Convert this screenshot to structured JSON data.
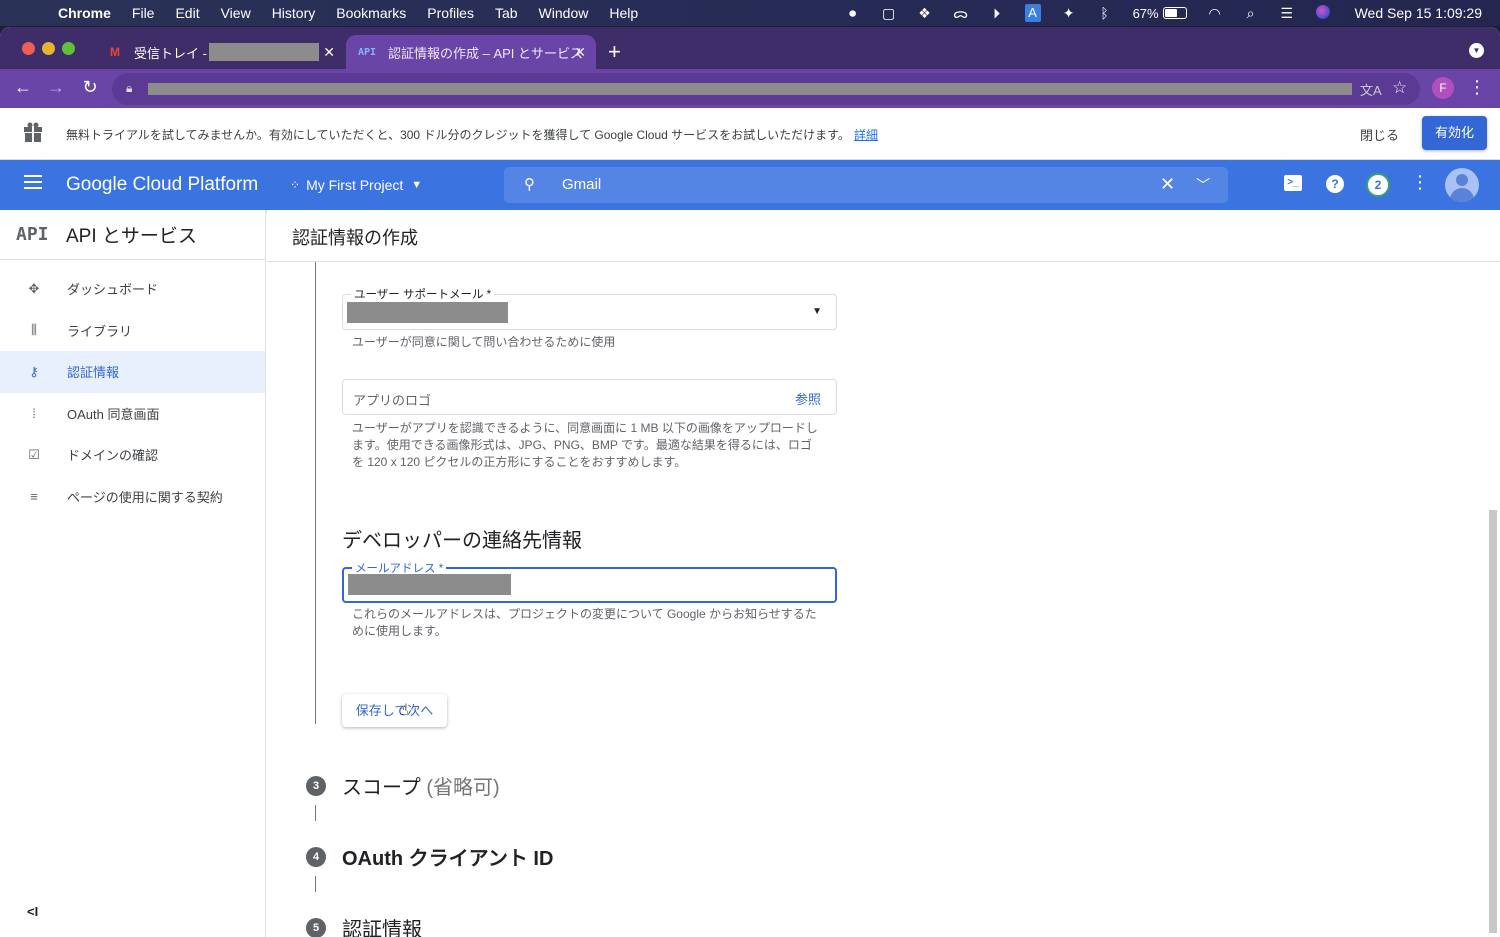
{
  "menubar": {
    "app": "Chrome",
    "items": [
      "File",
      "Edit",
      "View",
      "History",
      "Bookmarks",
      "Profiles",
      "Tab",
      "Window",
      "Help"
    ],
    "battery_percent": "67%",
    "battery_level": 0.67,
    "clock": "Wed Sep 15  1:09:29"
  },
  "browser": {
    "tabs": [
      {
        "favicon": "M",
        "title": "受信トレイ -",
        "active": false
      },
      {
        "favicon": "API",
        "title": "認証情報の作成 – API とサービス",
        "active": true
      }
    ],
    "profile_initial": "F"
  },
  "banner": {
    "message": "無料トライアルを試してみませんか。有効にしていただくと、300 ドル分のクレジットを獲得して Google Cloud サービスをお試しいただけます。",
    "details_link": "詳細",
    "close_label": "閉じる",
    "enable_label": "有効化"
  },
  "header": {
    "title": "Google Cloud Platform",
    "project": "My First Project",
    "search_value": "Gmail",
    "notification_count": "2"
  },
  "sidebar": {
    "logo": "API",
    "title": "API とサービス",
    "items": [
      {
        "icon": "dashboard-icon",
        "label": "ダッシュボード",
        "active": false
      },
      {
        "icon": "library-icon",
        "label": "ライブラリ",
        "active": false
      },
      {
        "icon": "key-icon",
        "label": "認証情報",
        "active": true
      },
      {
        "icon": "oauth-consent-icon",
        "label": "OAuth 同意画面",
        "active": false
      },
      {
        "icon": "domain-verification-icon",
        "label": "ドメインの確認",
        "active": false
      },
      {
        "icon": "page-usage-agreement-icon",
        "label": "ページの使用に関する契約",
        "active": false
      }
    ],
    "collapse_label": "<I"
  },
  "main": {
    "page_title": "認証情報の作成",
    "support_email": {
      "label": "ユーザー サポートメール *",
      "helper": "ユーザーが同意に関して問い合わせるために使用"
    },
    "app_logo": {
      "placeholder": "アプリのロゴ",
      "browse": "参照",
      "helper": "ユーザーがアプリを認識できるように、同意画面に 1 MB 以下の画像をアップロードします。使用できる画像形式は、JPG、PNG、BMP です。最適な結果を得るには、ロゴを 120 x 120 ピクセルの正方形にすることをおすすめします。"
    },
    "developer_section_title": "デベロッパーの連絡先情報",
    "developer_email": {
      "label": "メールアドレス *",
      "helper": "これらのメールアドレスは、プロジェクトの変更について Google からお知らせするために使用します。"
    },
    "save_button": "保存して次へ",
    "steps": [
      {
        "number": "3",
        "label": "スコープ",
        "optional": "(省略可)"
      },
      {
        "number": "4",
        "label": "OAuth クライアント ID",
        "optional": ""
      },
      {
        "number": "5",
        "label": "認証情報",
        "optional": ""
      }
    ]
  }
}
